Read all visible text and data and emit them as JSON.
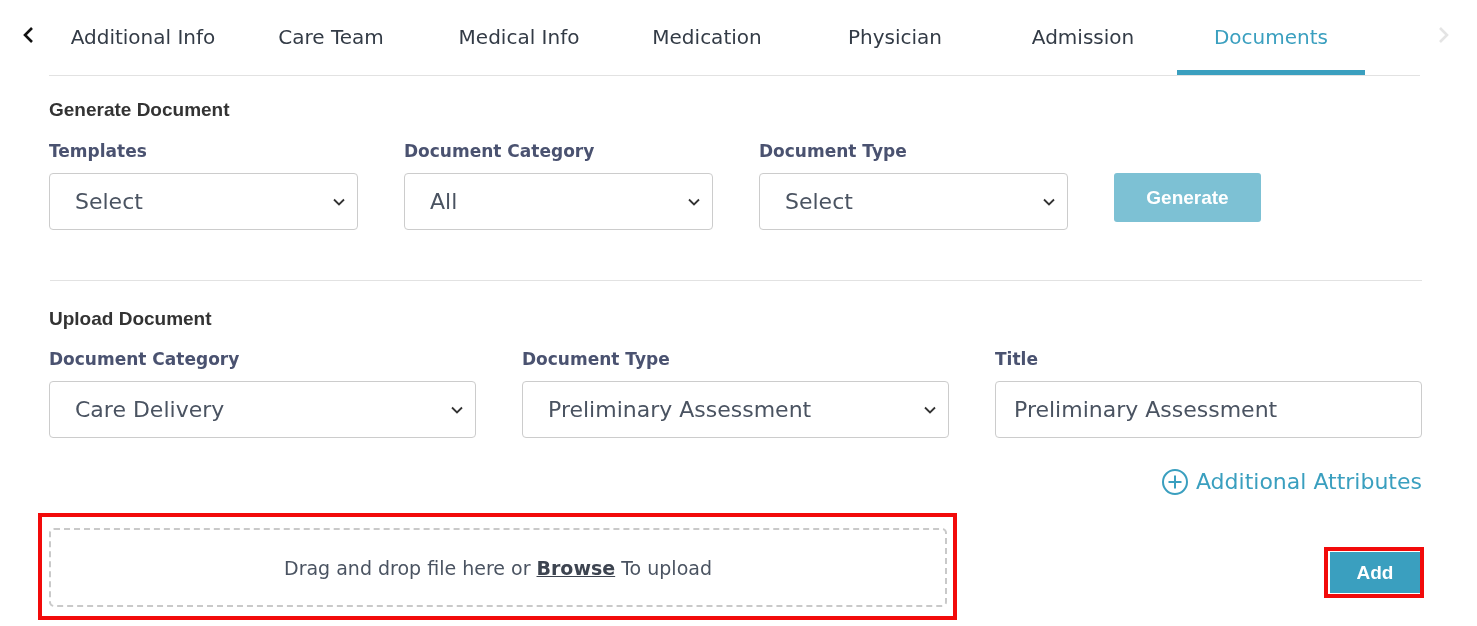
{
  "tabs": {
    "prev_arrow": {
      "disabled": false
    },
    "items": [
      {
        "label": "Additional Info",
        "selected": false
      },
      {
        "label": "Care Team",
        "selected": false
      },
      {
        "label": "Medical Info",
        "selected": false
      },
      {
        "label": "Medication",
        "selected": false
      },
      {
        "label": "Physician",
        "selected": false
      },
      {
        "label": "Admission",
        "selected": false
      },
      {
        "label": "Documents",
        "selected": true
      }
    ],
    "next_arrow": {
      "disabled": true
    }
  },
  "generate_document": {
    "title": "Generate Document",
    "fields": [
      {
        "kind": "select",
        "label": "Templates",
        "value": "Select"
      },
      {
        "kind": "select",
        "label": "Document Category",
        "value": "All"
      },
      {
        "kind": "select",
        "label": "Document Type",
        "value": "Select"
      }
    ],
    "button": {
      "label": "Generate",
      "disabled": true
    }
  },
  "upload_document": {
    "title": "Upload Document",
    "fields": [
      {
        "kind": "select",
        "label": "Document Category",
        "value": "Care Delivery"
      },
      {
        "kind": "select",
        "label": "Document Type",
        "value": "Preliminary Assessment"
      },
      {
        "kind": "text",
        "label": "Title",
        "value": "Preliminary Assessment"
      }
    ],
    "attributes_link": "Additional Attributes",
    "dropzone": {
      "text_before": "Drag and drop file here or",
      "link": "Browse",
      "text_after": "To upload",
      "highlighted": true
    },
    "add_button": {
      "label": "Add",
      "highlighted": true
    }
  }
}
